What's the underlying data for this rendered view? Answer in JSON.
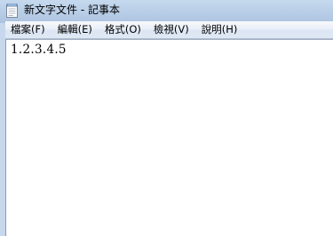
{
  "window": {
    "title": "新文字文件 - 記事本",
    "app_icon": "notepad-icon"
  },
  "menu": {
    "items": [
      {
        "label": "檔案(F)"
      },
      {
        "label": "編輯(E)"
      },
      {
        "label": "格式(O)"
      },
      {
        "label": "檢視(V)"
      },
      {
        "label": "說明(H)"
      }
    ]
  },
  "editor": {
    "content": "1.2.3.4.5"
  },
  "colors": {
    "frame": "#b9d1ea",
    "menubar": "#e3ebf6",
    "editor_bg": "#ffffff"
  }
}
